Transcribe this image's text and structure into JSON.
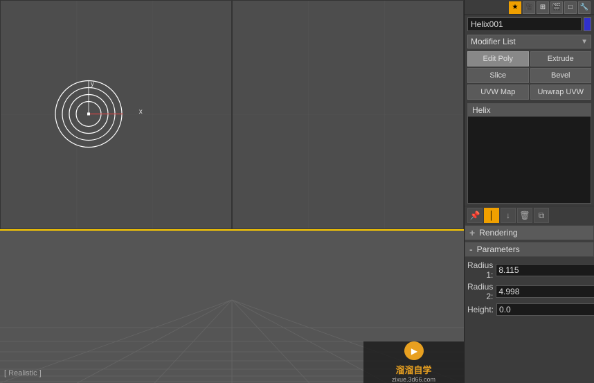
{
  "viewport": {
    "top_left_label": "",
    "top_right_label": "",
    "bottom_label": "[ Realistic ]"
  },
  "right_panel": {
    "object_name": "Helix001",
    "modifier_list_label": "Modifier List",
    "buttons": {
      "edit_poly": "Edit Poly",
      "extrude": "Extrude",
      "slice": "Slice",
      "bevel": "Bevel",
      "uvw_map": "UVW Map",
      "unwrap_uvw": "Unwrap UVW"
    },
    "stack_items": [
      {
        "label": "Helix",
        "selected": true
      }
    ],
    "rendering_label": "Rendering",
    "parameters_label": "Parameters",
    "params": {
      "radius1_label": "Radius 1:",
      "radius1_value": "8.115",
      "radius2_label": "Radius 2:",
      "radius2_value": "4.998",
      "height_label": "Height:",
      "height_value": "0.0"
    }
  },
  "watermark": {
    "site": "溜溜自学",
    "url": "zixue.3d66.com"
  },
  "icons": {
    "star": "★",
    "camera": "📷",
    "grid": "⊞",
    "film": "🎬",
    "square": "□",
    "hammer": "🔨",
    "pin_up": "▲",
    "pin_mid": "│",
    "trash": "🗑",
    "layers": "≡",
    "copy": "⧉"
  }
}
